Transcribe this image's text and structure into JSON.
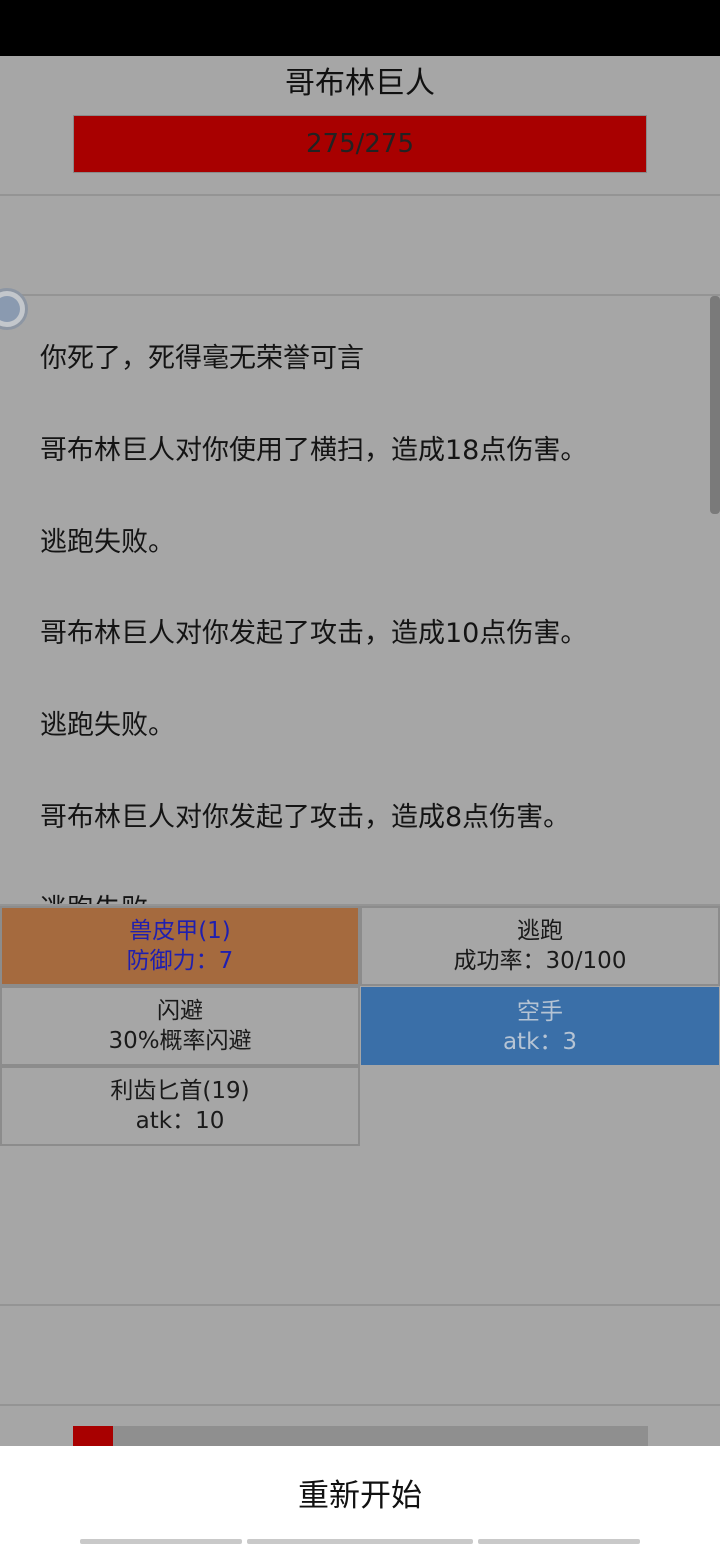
{
  "enemy": {
    "name": "哥布林巨人",
    "hp_text": "275/275",
    "hp_fraction": 1.0
  },
  "log": [
    "你死了，死得毫无荣誉可言",
    "哥布林巨人对你使用了横扫，造成18点伤害。",
    "逃跑失败。",
    "哥布林巨人对你发起了攻击，造成10点伤害。",
    "逃跑失败。",
    "哥布林巨人对你发起了攻击，造成8点伤害。",
    "逃跑失败。"
  ],
  "actions": {
    "armor": {
      "name": "兽皮甲(1)",
      "stat": "防御力：7"
    },
    "flee": {
      "name": "逃跑",
      "stat": "成功率：30/100"
    },
    "dodge": {
      "name": "闪避",
      "stat": "30%概率闪避"
    },
    "bare_hands": {
      "name": "空手",
      "stat": "atk：3"
    },
    "dagger": {
      "name": "利齿匕首(19)",
      "stat": "atk：10"
    }
  },
  "player": {
    "hp_fraction": 0.07
  },
  "bottom": {
    "restart_label": "重新开始"
  },
  "colors": {
    "background": "#a6a6a6",
    "hp_red": "#a80000",
    "armor_brown": "#a56a3e",
    "selected_blue": "#3a6fa8"
  }
}
